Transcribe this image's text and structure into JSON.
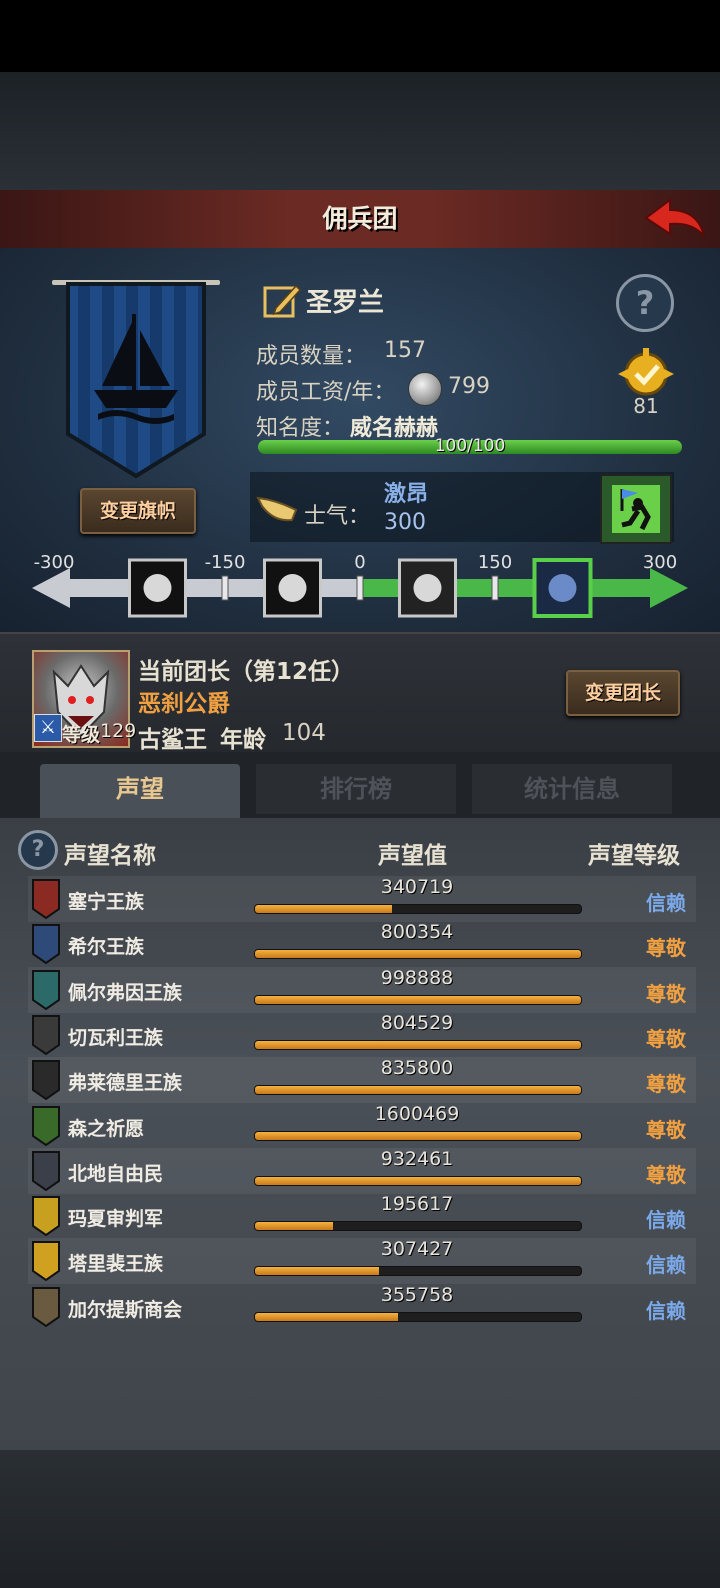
{
  "header": {
    "title": "佣兵团"
  },
  "guild": {
    "name": "圣罗兰",
    "members_label": "成员数量：",
    "members_value": "157",
    "salary_label": "成员工资/年：",
    "salary_value": "799",
    "fame_label": "知名度：",
    "fame_value": "威名赫赫",
    "fame_progress": "100/100",
    "fame_fraction": 1.0,
    "badge_value": "81",
    "change_banner_label": "变更旗帜"
  },
  "morale": {
    "label": "士气：",
    "state": "激昂",
    "value": "300",
    "scale_ticks": [
      "-300",
      "-150",
      "0",
      "150",
      "300"
    ],
    "scale_min": -300,
    "scale_max": 300,
    "current": 300
  },
  "leader": {
    "title": "当前团长（第12任）",
    "name": "恶刹公爵",
    "level_label": "等级",
    "level_value": "129",
    "race": "古鲨王",
    "age_label": "年龄",
    "age_value": "104",
    "change_leader_label": "变更团长"
  },
  "tabs": [
    {
      "label": "声望",
      "active": true
    },
    {
      "label": "排行榜",
      "active": false
    },
    {
      "label": "统计信息",
      "active": false
    }
  ],
  "table": {
    "headers": [
      "声望名称",
      "声望值",
      "声望等级"
    ],
    "rows": [
      {
        "name": "塞宁王族",
        "value": "340719",
        "fill": 0.42,
        "level": "信赖",
        "level_color": "#7aa8e8",
        "shield": "#8a2a22"
      },
      {
        "name": "希尔王族",
        "value": "800354",
        "fill": 1.0,
        "level": "尊敬",
        "level_color": "#f0a040",
        "shield": "#2e4a78"
      },
      {
        "name": "佩尔弗因王族",
        "value": "998888",
        "fill": 1.0,
        "level": "尊敬",
        "level_color": "#f0a040",
        "shield": "#2c6a6a"
      },
      {
        "name": "切瓦利王族",
        "value": "804529",
        "fill": 1.0,
        "level": "尊敬",
        "level_color": "#f0a040",
        "shield": "#3a3a3a"
      },
      {
        "name": "弗莱德里王族",
        "value": "835800",
        "fill": 1.0,
        "level": "尊敬",
        "level_color": "#f0a040",
        "shield": "#2a2a2a"
      },
      {
        "name": "森之祈愿",
        "value": "1600469",
        "fill": 1.0,
        "level": "尊敬",
        "level_color": "#f0a040",
        "shield": "#3a6a2a"
      },
      {
        "name": "北地自由民",
        "value": "932461",
        "fill": 1.0,
        "level": "尊敬",
        "level_color": "#f0a040",
        "shield": "#3a3f4a"
      },
      {
        "name": "玛夏审判军",
        "value": "195617",
        "fill": 0.24,
        "level": "信赖",
        "level_color": "#7aa8e8",
        "shield": "#c8a020"
      },
      {
        "name": "塔里裴王族",
        "value": "307427",
        "fill": 0.38,
        "level": "信赖",
        "level_color": "#7aa8e8",
        "shield": "#d0a020"
      },
      {
        "name": "加尔提斯商会",
        "value": "355758",
        "fill": 0.44,
        "level": "信赖",
        "level_color": "#7aa8e8",
        "shield": "#6a5a40"
      }
    ]
  }
}
